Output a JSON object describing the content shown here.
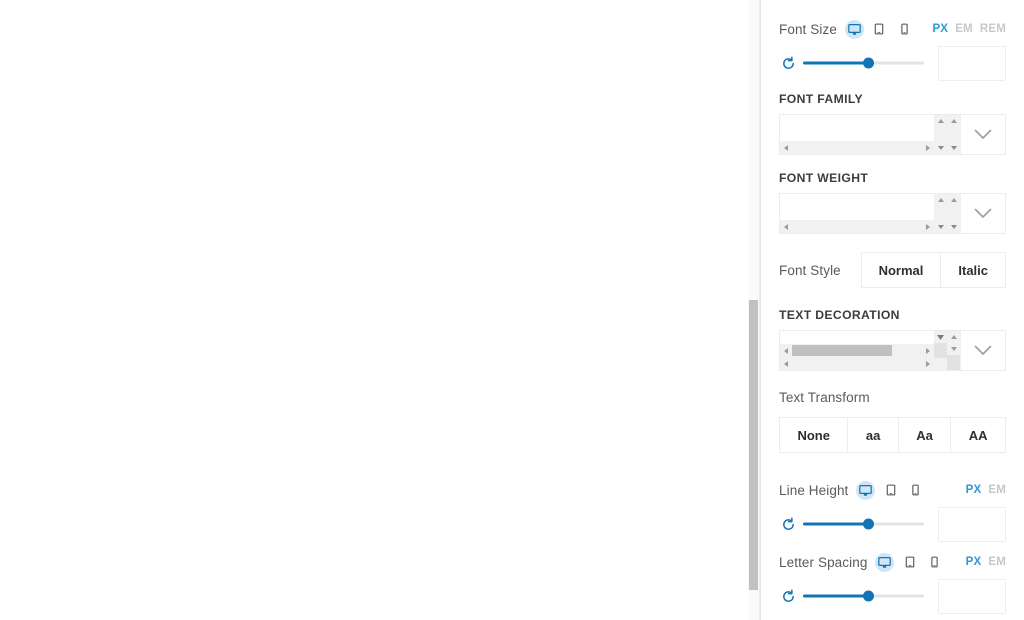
{
  "panel": {
    "scrollbar": {
      "name": "panel-vertical-scrollbar"
    },
    "accent_color": "#1273b5",
    "active_unit_color": "#2e9ad0",
    "inactive_unit_color": "#c5c9cd",
    "device_active_bg": "#cfe6f7"
  },
  "controls": {
    "font_size": {
      "label": "Font Size",
      "devices": [
        {
          "id": "desktop",
          "icon": "desktop-icon",
          "active": true
        },
        {
          "id": "tablet",
          "icon": "tablet-icon",
          "active": false
        },
        {
          "id": "mobile",
          "icon": "mobile-icon",
          "active": false
        }
      ],
      "units": [
        {
          "label": "PX",
          "active": true
        },
        {
          "label": "EM",
          "active": false
        },
        {
          "label": "REM",
          "active": false
        }
      ],
      "reset_icon": "reset-icon",
      "slider": {
        "percent": 54
      },
      "value": "",
      "placeholder": ""
    },
    "font_family": {
      "label": "FONT FAMILY",
      "value": "",
      "caret_icon": "chevron-down-icon",
      "h_scroll_thumb_percent": 0,
      "v_scroll": "none"
    },
    "font_weight": {
      "label": "FONT WEIGHT",
      "value": "",
      "caret_icon": "chevron-down-icon",
      "h_scroll_thumb_percent": 0,
      "v_scroll": "none"
    },
    "font_style": {
      "label": "Font Style",
      "options": [
        {
          "label": "Normal",
          "active": false
        },
        {
          "label": "Italic",
          "active": false
        }
      ]
    },
    "text_decoration": {
      "label": "TEXT DECORATION",
      "value": "",
      "caret_icon": "chevron-down-icon",
      "h_scroll_thumb_percent": 77,
      "v_scroll": "visible"
    },
    "text_transform": {
      "label": "Text Transform",
      "options": [
        {
          "label": "None",
          "active": false
        },
        {
          "label": "aa",
          "active": false
        },
        {
          "label": "Aa",
          "active": false
        },
        {
          "label": "AA",
          "active": false
        }
      ]
    },
    "line_height": {
      "label": "Line Height",
      "devices": [
        {
          "id": "desktop",
          "icon": "desktop-icon",
          "active": true
        },
        {
          "id": "tablet",
          "icon": "tablet-icon",
          "active": false
        },
        {
          "id": "mobile",
          "icon": "mobile-icon",
          "active": false
        }
      ],
      "units": [
        {
          "label": "PX",
          "active": true
        },
        {
          "label": "EM",
          "active": false
        }
      ],
      "reset_icon": "reset-icon",
      "slider": {
        "percent": 54
      },
      "value": "",
      "placeholder": ""
    },
    "letter_spacing": {
      "label": "Letter Spacing",
      "devices": [
        {
          "id": "desktop",
          "icon": "desktop-icon",
          "active": true
        },
        {
          "id": "tablet",
          "icon": "tablet-icon",
          "active": false
        },
        {
          "id": "mobile",
          "icon": "mobile-icon",
          "active": false
        }
      ],
      "units": [
        {
          "label": "PX",
          "active": true
        },
        {
          "label": "EM",
          "active": false
        }
      ],
      "reset_icon": "reset-icon",
      "slider": {
        "percent": 54
      },
      "value": "",
      "placeholder": ""
    }
  }
}
